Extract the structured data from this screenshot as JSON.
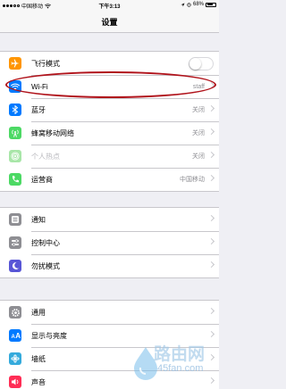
{
  "status_bar": {
    "carrier": "中国移动",
    "time": "下午3:13",
    "battery": "68%",
    "battery_level": 0.68
  },
  "nav": {
    "title": "设置"
  },
  "groups": [
    {
      "rows": [
        {
          "label": "飞行模式",
          "icon": "airplane-icon",
          "color": "#ff9500",
          "toggle": true,
          "toggle_on": false
        },
        {
          "label": "Wi-Fi",
          "icon": "wifi-icon",
          "color": "#007aff",
          "value": "staff"
        },
        {
          "label": "蓝牙",
          "icon": "bluetooth-icon",
          "color": "#007aff",
          "value": "关闭"
        },
        {
          "label": "蜂窝移动网络",
          "icon": "cellular-icon",
          "color": "#4cd964",
          "value": "关闭"
        },
        {
          "label": "个人热点",
          "icon": "hotspot-icon",
          "color": "#a8e6a8",
          "value": "关闭",
          "dim": true
        },
        {
          "label": "运营商",
          "icon": "phone-icon",
          "color": "#4cd964",
          "value": "中国移动"
        }
      ]
    },
    {
      "rows": [
        {
          "label": "通知",
          "icon": "notifications-icon",
          "color": "#8e8e93"
        },
        {
          "label": "控制中心",
          "icon": "control-center-icon",
          "color": "#8e8e93"
        },
        {
          "label": "勿扰模式",
          "icon": "moon-icon",
          "color": "#5856d6"
        }
      ]
    },
    {
      "rows": [
        {
          "label": "通用",
          "icon": "gear-icon",
          "color": "#8e8e93"
        },
        {
          "label": "显示与亮度",
          "icon": "display-icon",
          "color": "#007aff"
        },
        {
          "label": "墙纸",
          "icon": "wallpaper-icon",
          "color": "#34aadc"
        },
        {
          "label": "声音",
          "icon": "sound-icon",
          "color": "#ff2d55"
        }
      ]
    }
  ],
  "watermark": {
    "main": "路由网",
    "sub": "45fan.com"
  }
}
